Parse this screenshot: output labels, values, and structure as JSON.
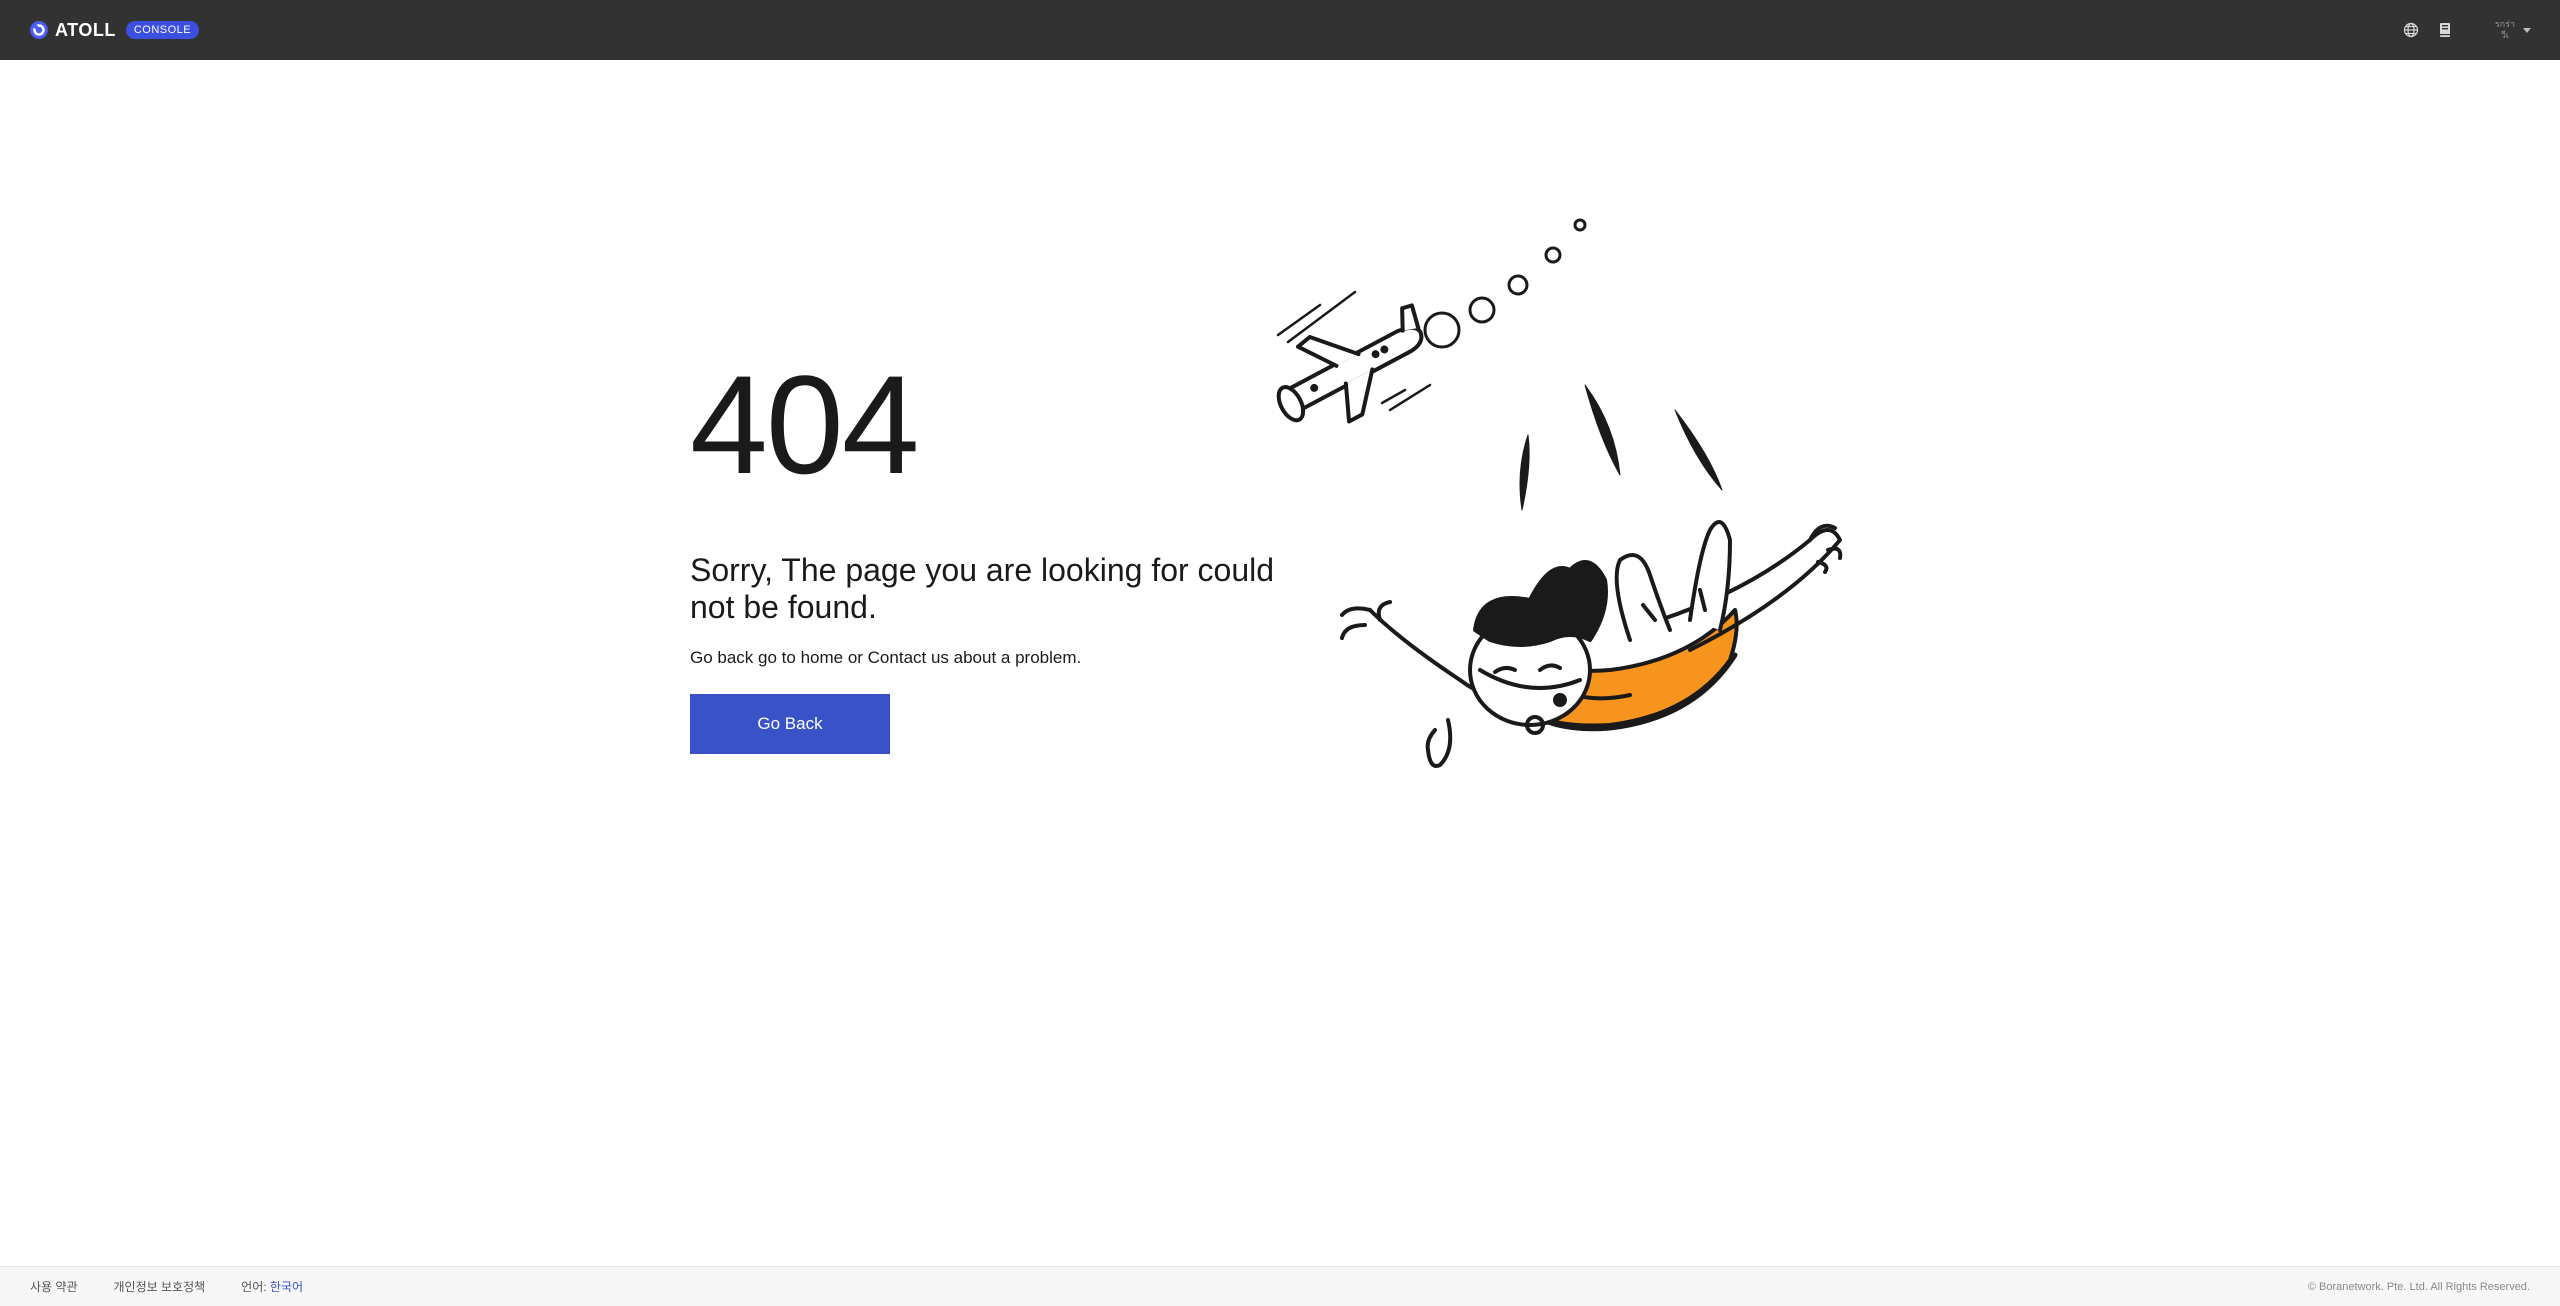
{
  "header": {
    "brand_name": "ATOLL",
    "badge": "CONSOLE",
    "user_line1": "รกร่า",
    "user_line2": "วีเ"
  },
  "error": {
    "code": "404",
    "title": "Sorry, The page you are looking for could not be found.",
    "description": "Go back go to home or Contact us about a problem.",
    "button_label": "Go Back"
  },
  "footer": {
    "terms": "사용 약관",
    "privacy": "개인정보 보호정책",
    "language_label": "언어:",
    "language_value": "한국어",
    "copyright": "© Boranetwork. Pte. Ltd. All Rights Reserved."
  },
  "icons": {
    "globe": "globe-icon",
    "book": "book-icon",
    "logo": "atoll-logo-icon"
  },
  "colors": {
    "header_bg": "#323232",
    "accent": "#3a52c7",
    "badge": "#3b4fe0",
    "illustration_orange": "#f7941d"
  }
}
